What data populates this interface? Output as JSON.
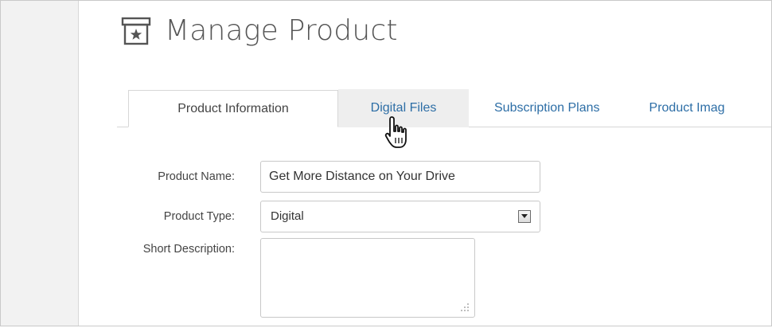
{
  "page": {
    "title": "Manage Product",
    "title_icon": "product-box-star-icon"
  },
  "tabs": [
    {
      "label": "Product Information",
      "state": "active"
    },
    {
      "label": "Digital Files",
      "state": "hover"
    },
    {
      "label": "Subscription Plans",
      "state": "normal"
    },
    {
      "label": "Product Imag",
      "state": "normal"
    }
  ],
  "form": {
    "product_name": {
      "label": "Product Name:",
      "value": "Get More Distance on Your Drive"
    },
    "product_type": {
      "label": "Product Type:",
      "value": "Digital"
    },
    "short_description": {
      "label": "Short Description:",
      "value": ""
    }
  },
  "colors": {
    "link": "#2d6ea6",
    "tab_hover_bg": "#eeeeee",
    "gutter_bg": "#f2f2f2",
    "border": "#c8c8c8"
  },
  "cursor": {
    "icon": "hand-pointer-icon"
  }
}
